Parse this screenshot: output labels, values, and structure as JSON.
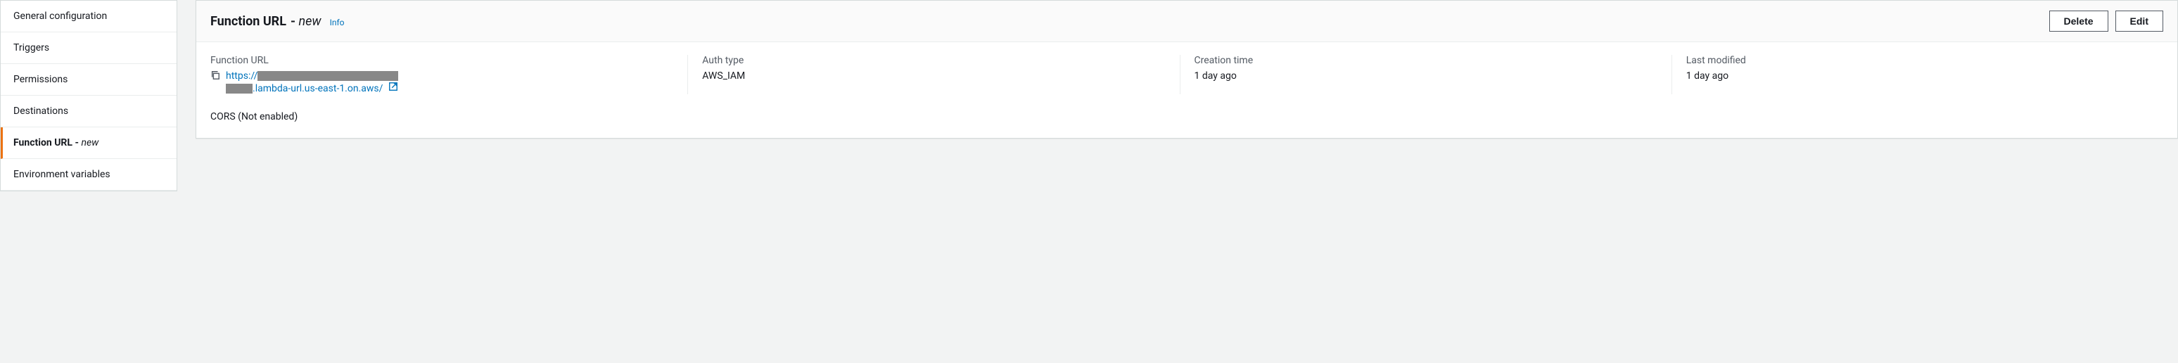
{
  "sidebar": {
    "items": [
      {
        "label": "General configuration",
        "active": false
      },
      {
        "label": "Triggers",
        "active": false
      },
      {
        "label": "Permissions",
        "active": false
      },
      {
        "label": "Destinations",
        "active": false
      },
      {
        "label": "Function URL",
        "badge": "new",
        "active": true
      },
      {
        "label": "Environment variables",
        "active": false
      }
    ]
  },
  "header": {
    "title": "Function URL",
    "badge": "new",
    "info": "Info",
    "actions": {
      "delete": "Delete",
      "edit": "Edit"
    }
  },
  "details": {
    "function_url": {
      "label": "Function URL",
      "value_prefix": "https://",
      "value_suffix": ".lambda-url.us-east-1.on.aws/"
    },
    "auth_type": {
      "label": "Auth type",
      "value": "AWS_IAM"
    },
    "creation_time": {
      "label": "Creation time",
      "value": "1 day ago"
    },
    "last_modified": {
      "label": "Last modified",
      "value": "1 day ago"
    }
  },
  "cors": {
    "label": "CORS (Not enabled)"
  }
}
